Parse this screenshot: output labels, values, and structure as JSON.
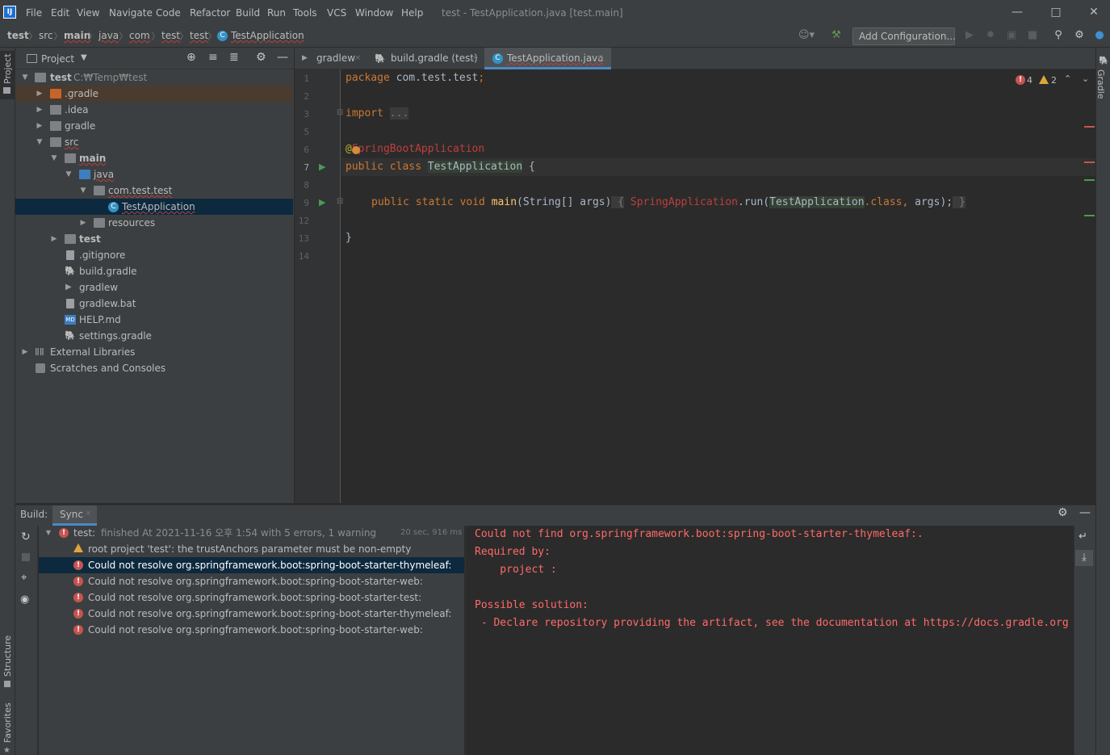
{
  "menu": [
    "File",
    "Edit",
    "View",
    "Navigate",
    "Code",
    "Refactor",
    "Build",
    "Run",
    "Tools",
    "VCS",
    "Window",
    "Help"
  ],
  "window_title": "test - TestApplication.java [test.main]",
  "app_icon": "IJ",
  "breadcrumbs": [
    "test",
    "src",
    "main",
    "java",
    "com",
    "test",
    "test",
    "TestApplication"
  ],
  "toolbar": {
    "add_configuration": "Add Configuration..."
  },
  "left_stripe": {
    "project": "Project",
    "structure": "Structure",
    "favorites": "Favorites"
  },
  "right_stripe": {
    "gradle": "Gradle"
  },
  "project_panel": {
    "title": "Project",
    "root_name": "test",
    "root_path": "C:₩Temp₩test",
    "items": [
      {
        "label": ".gradle"
      },
      {
        "label": ".idea"
      },
      {
        "label": "gradle"
      },
      {
        "label": "src"
      },
      {
        "label": "main"
      },
      {
        "label": "java"
      },
      {
        "label": "com.test.test"
      },
      {
        "label": "TestApplication"
      },
      {
        "label": "resources"
      },
      {
        "label": "test"
      },
      {
        "label": ".gitignore"
      },
      {
        "label": "build.gradle"
      },
      {
        "label": "gradlew"
      },
      {
        "label": "gradlew.bat"
      },
      {
        "label": "HELP.md"
      },
      {
        "label": "settings.gradle"
      },
      {
        "label": "External Libraries"
      },
      {
        "label": "Scratches and Consoles"
      }
    ]
  },
  "editor_tabs": [
    {
      "label": "gradlew"
    },
    {
      "label": "build.gradle (test)"
    },
    {
      "label": "TestApplication.java",
      "active": true
    }
  ],
  "inspection": {
    "errors": "4",
    "warnings": "2"
  },
  "code": {
    "line_numbers": [
      "1",
      "2",
      "3",
      "5",
      "6",
      "7",
      "8",
      "9",
      "12",
      "13",
      "14"
    ],
    "package_kw": "package",
    "package_name": " com.test.test",
    "semicolon": ";",
    "import_kw": "import",
    "import_fold": "...",
    "annotation_at": "@",
    "annotation_name": "SpringBootApplication",
    "class_kw": "public class",
    "class_name": "TestApplication",
    "class_brace": " {",
    "method_kw": "public static void",
    "method_name": "main",
    "method_params": "(String[] args)",
    "body_open": " {",
    "body_class": "SpringApplication",
    "body_run": ".run(",
    "body_arg": "TestApplication",
    "body_dot_class": ".class,",
    "body_rest": " args);",
    "body_close": " }",
    "close_brace": "}"
  },
  "build_panel": {
    "title": "Build:",
    "tab": "Sync",
    "summary_bold": "test:",
    "summary_text": "finished At 2021-11-16 오후 1:54 with 5 errors, 1 warning",
    "duration": "20 sec, 916 ms",
    "rows": [
      {
        "type": "warning",
        "text": "root project 'test': the trustAnchors parameter must be non-empty"
      },
      {
        "type": "error",
        "text": "Could not resolve org.springframework.boot:spring-boot-starter-thymeleaf:"
      },
      {
        "type": "error",
        "text": "Could not resolve org.springframework.boot:spring-boot-starter-web:"
      },
      {
        "type": "error",
        "text": "Could not resolve org.springframework.boot:spring-boot-starter-test:"
      },
      {
        "type": "error",
        "text": "Could not resolve org.springframework.boot:spring-boot-starter-thymeleaf:"
      },
      {
        "type": "error",
        "text": "Could not resolve org.springframework.boot:spring-boot-starter-web:"
      }
    ],
    "console": [
      "Could not find org.springframework.boot:spring-boot-starter-thymeleaf:.",
      "Required by:",
      "    project :",
      "",
      "Possible solution:",
      " - Declare repository providing the artifact, see the documentation at https://docs.gradle.org"
    ]
  },
  "colors": {
    "accent": "#4a88c7",
    "error": "#c75450",
    "warning": "#e0a53a",
    "console_error": "#ff6b68"
  }
}
